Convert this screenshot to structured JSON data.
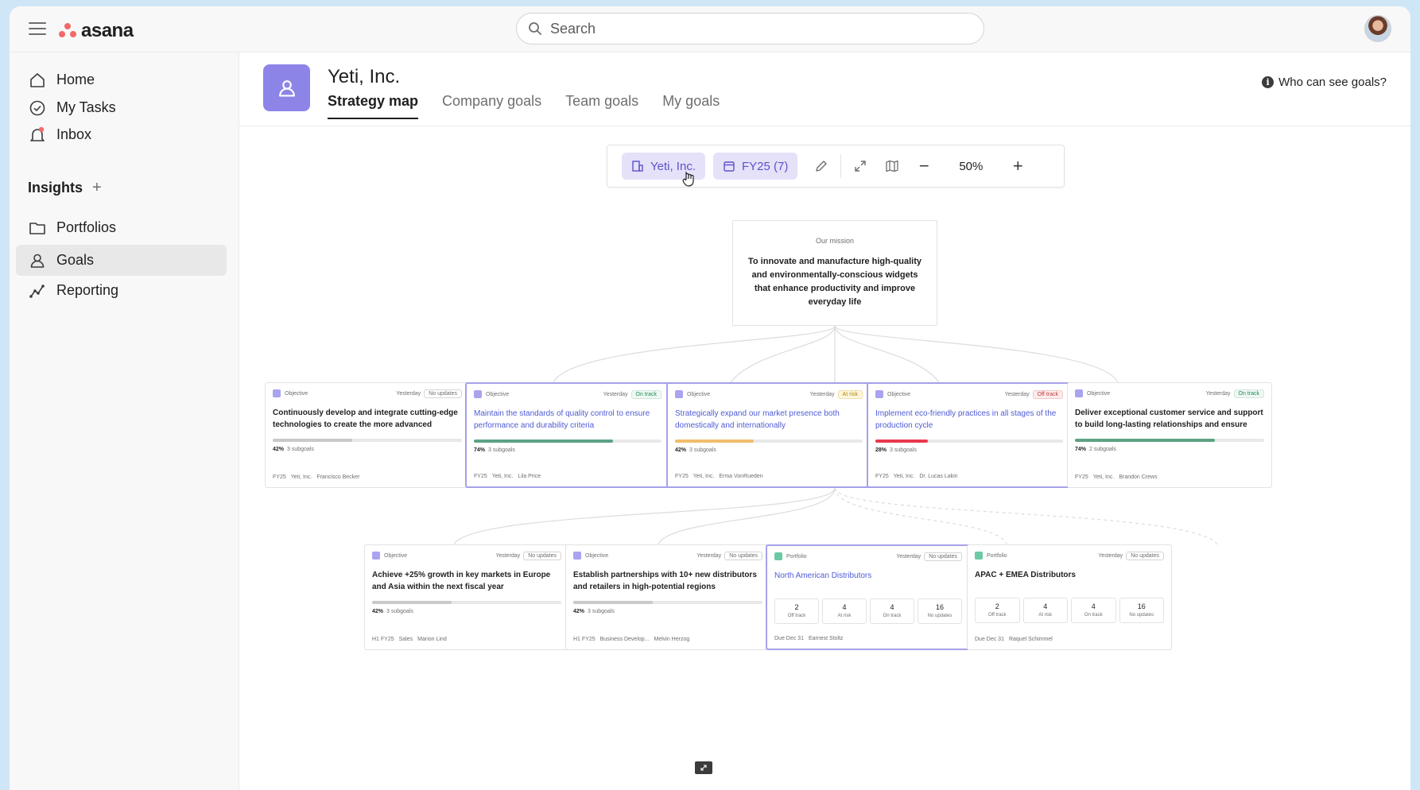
{
  "app": {
    "logo_text": "asana"
  },
  "search": {
    "placeholder": "Search"
  },
  "sidebar": {
    "items": [
      {
        "label": "Home",
        "icon": "home-icon"
      },
      {
        "label": "My Tasks",
        "icon": "check-circle-icon"
      },
      {
        "label": "Inbox",
        "icon": "bell-icon"
      }
    ],
    "insights_label": "Insights",
    "insights_plus": "+",
    "insight_items": [
      {
        "label": "Portfolios",
        "icon": "folder-icon"
      },
      {
        "label": "Goals",
        "icon": "person-icon",
        "active": true
      },
      {
        "label": "Reporting",
        "icon": "chart-line-icon"
      }
    ]
  },
  "header": {
    "title": "Yeti, Inc.",
    "tabs": [
      "Strategy map",
      "Company goals",
      "Team goals",
      "My goals"
    ],
    "active_tab": "Strategy map",
    "who_can_see": "Who can see goals?",
    "info_glyph": "i"
  },
  "toolbar": {
    "org_chip": "Yeti, Inc.",
    "period_chip": "FY25 (7)",
    "zoom": "50%",
    "zoom_out": "−",
    "zoom_in": "+"
  },
  "mission": {
    "label": "Our mission",
    "text": "To innovate and manufacture high-quality and environmentally-conscious widgets that enhance productivity and improve everyday life"
  },
  "objectives": [
    {
      "type": "Objective",
      "time": "Yesterday",
      "status": "No updates",
      "status_kind": "none",
      "title": "Continuously develop and integrate cutting-edge technologies to create the more advanced widgets",
      "pct": "42%",
      "progress": 0.42,
      "bar_color": "#c9c9c9",
      "subgoals": "3 subgoals",
      "period": "FY25",
      "team": "Yeti, Inc.",
      "owner": "Francisco Becker",
      "highlighted": false
    },
    {
      "type": "Objective",
      "time": "Yesterday",
      "status": "On track",
      "status_kind": "on",
      "title": "Maintain the standards of quality control to ensure performance and durability criteria",
      "pct": "74%",
      "progress": 0.74,
      "bar_color": "#5da283",
      "subgoals": "3 subgoals",
      "period": "FY25",
      "team": "Yeti, Inc.",
      "owner": "Lila Price",
      "highlighted": true
    },
    {
      "type": "Objective",
      "time": "Yesterday",
      "status": "At risk",
      "status_kind": "risk",
      "title": "Strategically expand our market presence both domestically and internationally",
      "pct": "42%",
      "progress": 0.42,
      "bar_color": "#f1bd6c",
      "subgoals": "3 subgoals",
      "period": "FY25",
      "team": "Yeti, Inc.",
      "owner": "Erma VonRueden",
      "highlighted": true
    },
    {
      "type": "Objective",
      "time": "Yesterday",
      "status": "Off track",
      "status_kind": "off",
      "title": "Implement eco-friendly practices in all stages of the production cycle",
      "pct": "28%",
      "progress": 0.28,
      "bar_color": "#e8384f",
      "subgoals": "3 subgoals",
      "period": "FY25",
      "team": "Yeti, Inc.",
      "owner": "Dr. Lucas Lakin",
      "highlighted": true
    },
    {
      "type": "Objective",
      "time": "Yesterday",
      "status": "On track",
      "status_kind": "on",
      "title": "Deliver exceptional customer service and support to build long-lasting relationships and ensure client s...",
      "pct": "74%",
      "progress": 0.74,
      "bar_color": "#5da283",
      "subgoals": "2 subgoals",
      "period": "FY25",
      "team": "Yeti, Inc.",
      "owner": "Brandon Crews",
      "highlighted": false
    }
  ],
  "subgoals": [
    {
      "type": "Objective",
      "time": "Yesterday",
      "status": "No updates",
      "title": "Achieve +25% growth in key markets in Europe and Asia within the next fiscal year",
      "pct": "42%",
      "progress": 0.42,
      "subgoals": "3 subgoals",
      "period": "H1 FY25",
      "team": "Sales",
      "owner": "Marion Lind"
    },
    {
      "type": "Objective",
      "time": "Yesterday",
      "status": "No updates",
      "title": "Establish partnerships with 10+ new distributors and retailers in high-potential regions",
      "pct": "42%",
      "progress": 0.42,
      "subgoals": "3 subgoals",
      "period": "H1 FY25",
      "team": "Business Develop...",
      "owner": "Melvin Herzog"
    }
  ],
  "portfolios": [
    {
      "type": "Portfolio",
      "time": "Yesterday",
      "status": "No updates",
      "title": "North American Distributors",
      "highlighted": true,
      "stats": [
        {
          "n": "2",
          "l": "Off track"
        },
        {
          "n": "4",
          "l": "At risk"
        },
        {
          "n": "4",
          "l": "On track"
        },
        {
          "n": "16",
          "l": "No updates"
        }
      ],
      "due": "Due Dec 31",
      "owner": "Earnest Stoltz"
    },
    {
      "type": "Portfolio",
      "time": "Yesterday",
      "status": "No updates",
      "title": "APAC + EMEA Distributors",
      "highlighted": false,
      "stats": [
        {
          "n": "2",
          "l": "Off track"
        },
        {
          "n": "4",
          "l": "At risk"
        },
        {
          "n": "4",
          "l": "On track"
        },
        {
          "n": "16",
          "l": "No updates"
        }
      ],
      "due": "Due Dec 31",
      "owner": "Raquel Schimmel"
    }
  ],
  "colors": {
    "accent": "#8d84e8",
    "chip_bg": "#e4e1f9",
    "chip_text": "#5c52c9",
    "logo": "#f06a6a"
  }
}
